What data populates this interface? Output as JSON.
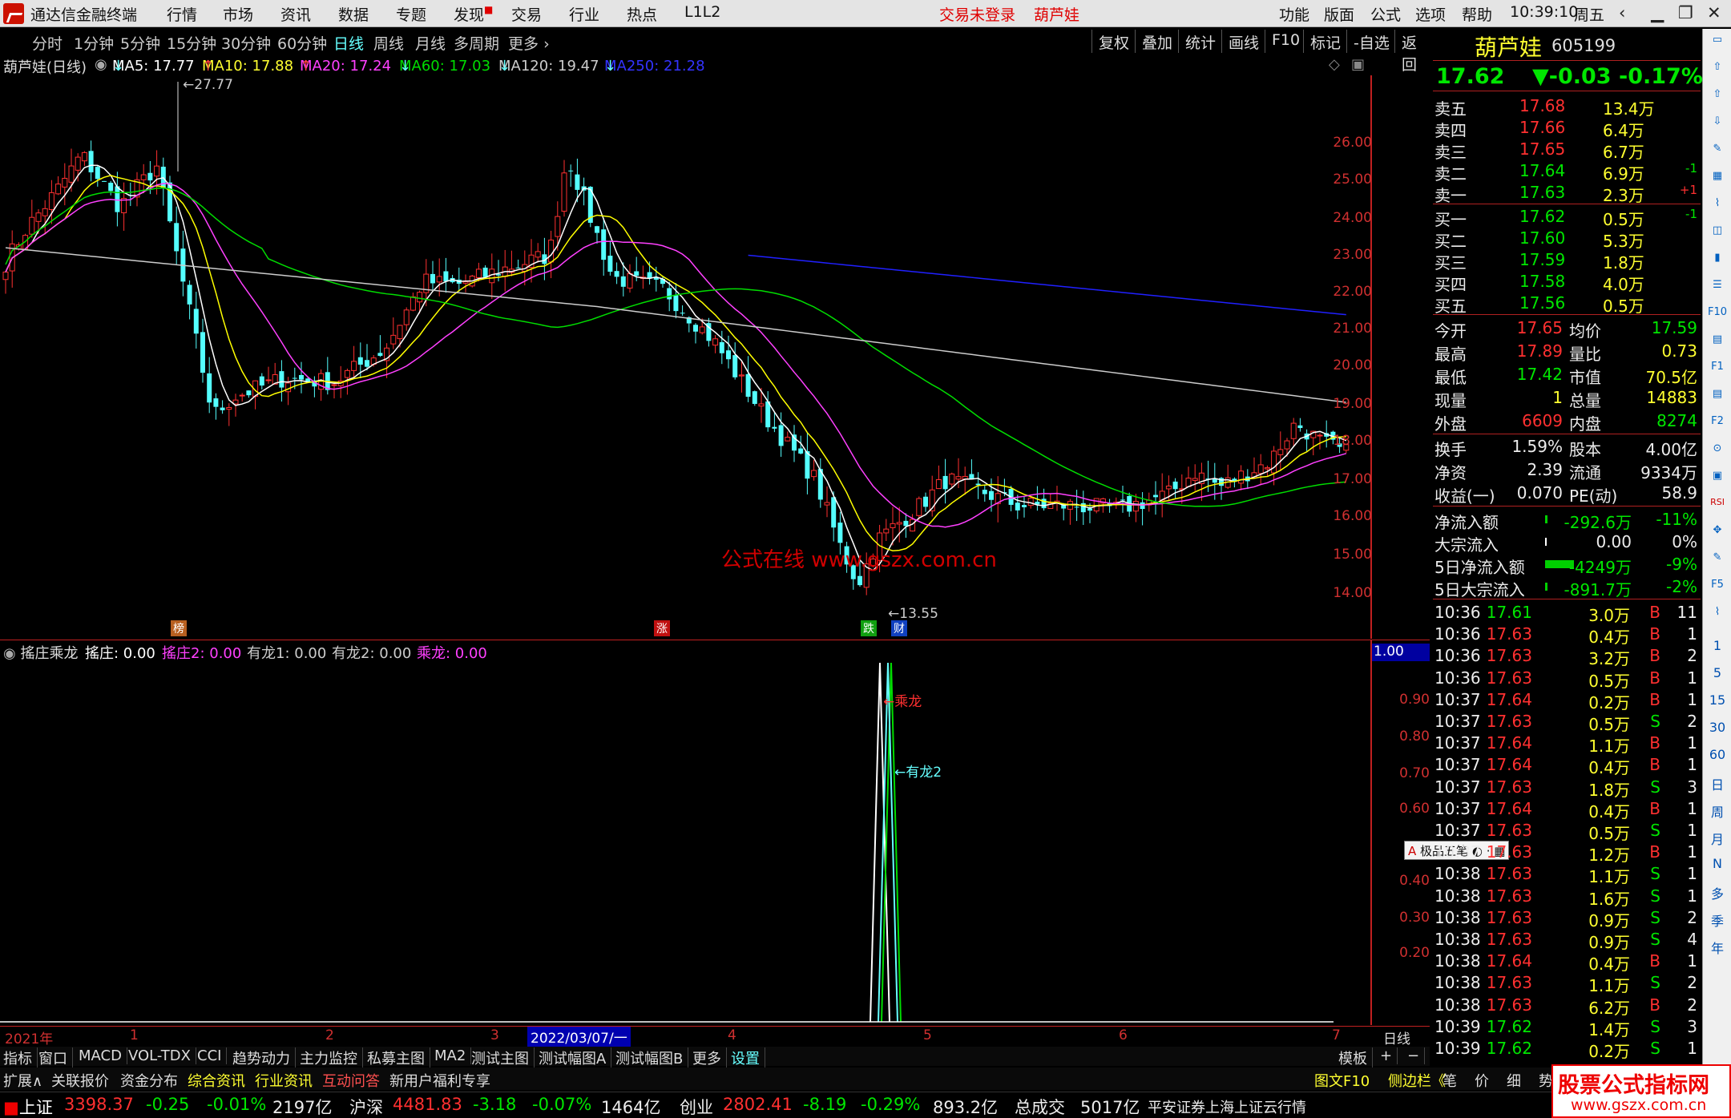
{
  "app": {
    "title": "通达信金融终端",
    "menu": [
      "行情",
      "市场",
      "资讯",
      "数据",
      "专题",
      "发现",
      "交易",
      "行业",
      "热点",
      "L1L2"
    ],
    "login_status": "交易未登录",
    "stock_short": "葫芦娃",
    "right_menu": [
      "功能",
      "版面",
      "公式",
      "选项",
      "帮助"
    ],
    "time": "10:39:10",
    "weekday": "周五",
    "window_controls": [
      "arrow-left-icon",
      "minimize-icon",
      "restore-icon",
      "close-icon"
    ]
  },
  "period_bar": {
    "items": [
      "分时",
      "1分钟",
      "5分钟",
      "15分钟",
      "30分钟",
      "60分钟",
      "日线",
      "周线",
      "月线",
      "多周期",
      "更多"
    ],
    "selected": "日线",
    "tools": [
      "复权",
      "叠加",
      "统计",
      "画线",
      "F10",
      "标记",
      "-自选",
      "返回"
    ]
  },
  "ma_legend": {
    "title": "葫芦娃(日线)",
    "ma5": "MA5: 17.77",
    "ma10": "MA10: 17.88",
    "ma20": "MA20: 17.24",
    "ma60": "MA60: 17.03",
    "ma120": "MA120: 19.47",
    "ma250": "MA250: 21.28",
    "colors": {
      "ma5": "#ffffff",
      "ma10": "#ffff00",
      "ma20": "#ff40ff",
      "ma60": "#00dd00",
      "ma120": "#cccccc",
      "ma250": "#2020ff"
    }
  },
  "price_chart": {
    "y_ticks": [
      "26.00",
      "25.00",
      "24.00",
      "23.00",
      "22.00",
      "21.00",
      "20.00",
      "19.00",
      "18.00",
      "17.00",
      "16.00",
      "15.00",
      "14.00"
    ],
    "high_label": "27.77",
    "low_label": "13.55",
    "markers": [
      "榜",
      "涨",
      "跌",
      "财"
    ],
    "watermark": "公式在线  www.gszx.com.cn"
  },
  "indicator": {
    "name": "搖庄乘龙",
    "v1": "搖庄: 0.00",
    "v2": "搖庄2: 0.00",
    "v3": "有龙1: 0.00",
    "v4": "有龙2: 0.00",
    "v5": "乘龙: 0.00",
    "y_ticks": [
      "1.00",
      "0.90",
      "0.80",
      "0.70",
      "0.60",
      "0.40",
      "0.30",
      "0.20"
    ],
    "ann1": "←乘龙",
    "ann2": "←有龙2",
    "ime": "极品五笔"
  },
  "date_axis": {
    "labels": [
      "2021年",
      "1",
      "2",
      "3",
      "4",
      "5",
      "6",
      "7"
    ],
    "cursor": "2022/03/07/一",
    "mode": "日线"
  },
  "quote": {
    "name": "葫芦娃",
    "code": "605199",
    "price": "17.62",
    "change": "▼-0.03",
    "pct": "-0.17%",
    "asks": [
      {
        "label": "卖五",
        "price": "17.68",
        "vol": "13.4万",
        "chg": ""
      },
      {
        "label": "卖四",
        "price": "17.66",
        "vol": "6.4万",
        "chg": ""
      },
      {
        "label": "卖三",
        "price": "17.65",
        "vol": "6.7万",
        "chg": ""
      },
      {
        "label": "卖二",
        "price": "17.64",
        "vol": "6.9万",
        "chg": "-1"
      },
      {
        "label": "卖一",
        "price": "17.63",
        "vol": "2.3万",
        "chg": "+1"
      }
    ],
    "bids": [
      {
        "label": "买一",
        "price": "17.62",
        "vol": "0.5万",
        "chg": "-1"
      },
      {
        "label": "买二",
        "price": "17.60",
        "vol": "5.3万",
        "chg": ""
      },
      {
        "label": "买三",
        "price": "17.59",
        "vol": "1.8万",
        "chg": ""
      },
      {
        "label": "买四",
        "price": "17.58",
        "vol": "4.0万",
        "chg": ""
      },
      {
        "label": "买五",
        "price": "17.56",
        "vol": "0.5万",
        "chg": ""
      }
    ],
    "stats": [
      {
        "l1": "今开",
        "v1": "17.65",
        "l2": "均价",
        "v2": "17.59"
      },
      {
        "l1": "最高",
        "v1": "17.89",
        "l2": "量比",
        "v2": "0.73"
      },
      {
        "l1": "最低",
        "v1": "17.42",
        "l2": "市值",
        "v2": "70.5亿"
      },
      {
        "l1": "现量",
        "v1": "1",
        "l2": "总量",
        "v2": "14883"
      },
      {
        "l1": "外盘",
        "v1": "6609",
        "l2": "内盘",
        "v2": "8274"
      },
      {
        "l1": "换手",
        "v1": "1.59%",
        "l2": "股本",
        "v2": "4.00亿"
      },
      {
        "l1": "净资",
        "v1": "2.39",
        "l2": "流通",
        "v2": "9334万"
      },
      {
        "l1": "收益(一)",
        "v1": "0.070",
        "l2": "PE(动)",
        "v2": "58.9"
      }
    ],
    "flows": [
      {
        "label": "净流入额",
        "val": "-292.6万",
        "pct": "-11%"
      },
      {
        "label": "大宗流入",
        "val": "0.00",
        "pct": "0%"
      },
      {
        "label": "5日净流入额",
        "val": "-4249万",
        "pct": "-9%"
      },
      {
        "label": "5日大宗流入",
        "val": "-891.7万",
        "pct": "-2%"
      }
    ],
    "ticks": [
      {
        "t": "10:36",
        "p": "17.61",
        "v": "3.0万",
        "bs": "B",
        "n": "11"
      },
      {
        "t": "10:36",
        "p": "17.63",
        "v": "0.4万",
        "bs": "B",
        "n": "1"
      },
      {
        "t": "10:36",
        "p": "17.63",
        "v": "3.2万",
        "bs": "B",
        "n": "2"
      },
      {
        "t": "10:36",
        "p": "17.63",
        "v": "0.5万",
        "bs": "B",
        "n": "1"
      },
      {
        "t": "10:37",
        "p": "17.64",
        "v": "0.2万",
        "bs": "B",
        "n": "1"
      },
      {
        "t": "10:37",
        "p": "17.63",
        "v": "0.5万",
        "bs": "S",
        "n": "2"
      },
      {
        "t": "10:37",
        "p": "17.64",
        "v": "1.1万",
        "bs": "B",
        "n": "1"
      },
      {
        "t": "10:37",
        "p": "17.64",
        "v": "0.4万",
        "bs": "B",
        "n": "1"
      },
      {
        "t": "10:37",
        "p": "17.63",
        "v": "1.8万",
        "bs": "S",
        "n": "3"
      },
      {
        "t": "10:37",
        "p": "17.64",
        "v": "0.4万",
        "bs": "B",
        "n": "1"
      },
      {
        "t": "10:37",
        "p": "17.63",
        "v": "0.5万",
        "bs": "S",
        "n": "1"
      },
      {
        "t": "10:37",
        "p": "17.63",
        "v": "1.2万",
        "bs": "B",
        "n": "1"
      },
      {
        "t": "10:38",
        "p": "17.63",
        "v": "1.1万",
        "bs": "S",
        "n": "1"
      },
      {
        "t": "10:38",
        "p": "17.63",
        "v": "1.6万",
        "bs": "S",
        "n": "1"
      },
      {
        "t": "10:38",
        "p": "17.63",
        "v": "0.9万",
        "bs": "S",
        "n": "2"
      },
      {
        "t": "10:38",
        "p": "17.63",
        "v": "0.9万",
        "bs": "S",
        "n": "4"
      },
      {
        "t": "10:38",
        "p": "17.64",
        "v": "0.4万",
        "bs": "B",
        "n": "1"
      },
      {
        "t": "10:38",
        "p": "17.63",
        "v": "1.1万",
        "bs": "S",
        "n": "2"
      },
      {
        "t": "10:38",
        "p": "17.63",
        "v": "6.2万",
        "bs": "B",
        "n": "2"
      },
      {
        "t": "10:39",
        "p": "17.62",
        "v": "1.4万",
        "bs": "S",
        "n": "3"
      },
      {
        "t": "10:39",
        "p": "17.62",
        "v": "0.2万",
        "bs": "S",
        "n": "1"
      }
    ]
  },
  "indicator_tabs": [
    "指标",
    "窗口",
    "MACD",
    "VOL-TDX",
    "CCI",
    "趋势动力",
    "主力监控",
    "私募主图",
    "MA2",
    "测试主图",
    "测试幅图A",
    "测试幅图B",
    "更多",
    "设置"
  ],
  "indicator_tabs_right": [
    "模板",
    "+",
    "−"
  ],
  "info_tabs": [
    "扩展∧",
    "关联报价",
    "资金分布",
    "综合资讯",
    "行业资讯",
    "互动问答",
    "新用户福利专享"
  ],
  "info_right": [
    "图文F10",
    "侧边栏《",
    "笔",
    "价",
    "细",
    "势"
  ],
  "status": {
    "items": [
      {
        "name": "上证",
        "val": "3398.37",
        "chg": "-0.25",
        "pct": "-0.01%",
        "amt": "2197亿"
      },
      {
        "name": "沪深",
        "val": "4481.83",
        "chg": "-3.18",
        "pct": "-0.07%",
        "amt": "1464亿"
      },
      {
        "name": "创业",
        "val": "2802.41",
        "chg": "-8.19",
        "pct": "-0.29%",
        "amt": "893.2亿"
      }
    ],
    "total_label": "总成交",
    "total_val": "5017亿",
    "broker": "平安证券上海上证云行情"
  },
  "watermark_logo": {
    "line1": "股票公式指标网",
    "line2": "www.gszx.com.cn"
  },
  "side_icons": [
    "collapse-icon",
    "up-icon",
    "up-arrow-icon",
    "down-icon",
    "note-icon",
    "table-icon",
    "chart-icon",
    "minute-icon",
    "candle-icon",
    "list-icon",
    "f10-icon",
    "page-icon",
    "f10b-icon",
    "page2-icon",
    "f2-icon",
    "cycle-icon",
    "screen-icon",
    "rsi-icon",
    "target-icon",
    "pen-icon",
    "f5-icon",
    "chart2-icon"
  ],
  "side_periods": [
    "1",
    "5",
    "15",
    "30",
    "60",
    "日",
    "周",
    "月",
    "N",
    "多",
    "季",
    "年"
  ]
}
